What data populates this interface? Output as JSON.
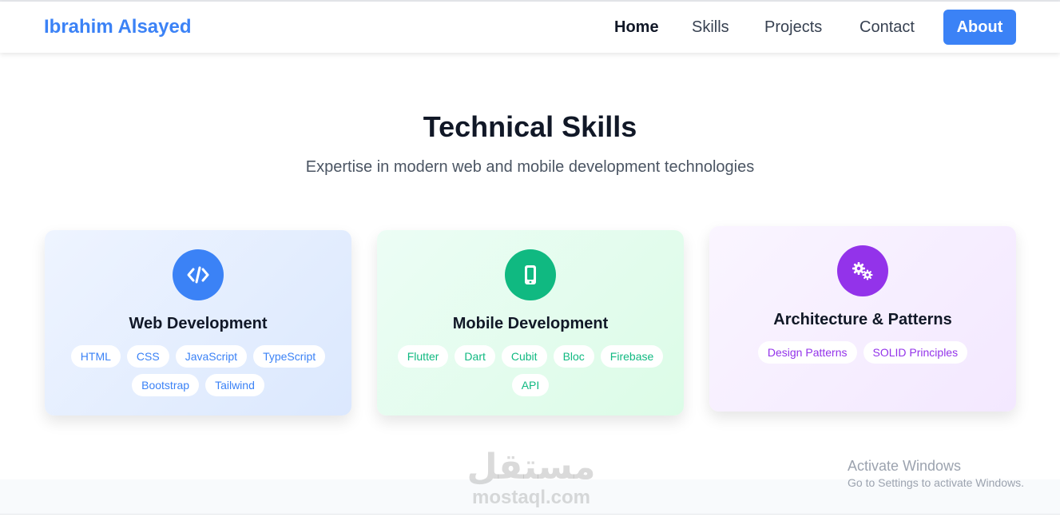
{
  "nav": {
    "brand": "Ibrahim Alsayed",
    "links": [
      {
        "label": "Home",
        "active": true
      },
      {
        "label": "Skills"
      },
      {
        "label": "Projects"
      },
      {
        "label": "Contact"
      }
    ],
    "about_label": "About"
  },
  "skills": {
    "title": "Technical Skills",
    "subtitle": "Expertise in modern web and mobile development technologies",
    "cards": [
      {
        "title": "Web Development",
        "icon": "code-icon",
        "icon_color": "#3b82f6",
        "tags": [
          "HTML",
          "CSS",
          "JavaScript",
          "TypeScript",
          "Bootstrap",
          "Tailwind"
        ]
      },
      {
        "title": "Mobile Development",
        "icon": "mobile-phone-icon",
        "icon_color": "#10b981",
        "tags": [
          "Flutter",
          "Dart",
          "Cubit",
          "Bloc",
          "Firebase",
          "API"
        ]
      },
      {
        "title": "Architecture & Patterns",
        "icon": "cogs-icon",
        "icon_color": "#9333ea",
        "tags": [
          "Design Patterns",
          "SOLID Principles"
        ]
      }
    ]
  },
  "watermark": {
    "arabic": "مستقل",
    "latin": "mostaql.com"
  },
  "system_overlay": {
    "line1": "Activate Windows",
    "line2": "Go to Settings to activate Windows."
  },
  "colors": {
    "accent": "#3b82f6",
    "mobile": "#10b981",
    "architecture": "#9333ea"
  }
}
